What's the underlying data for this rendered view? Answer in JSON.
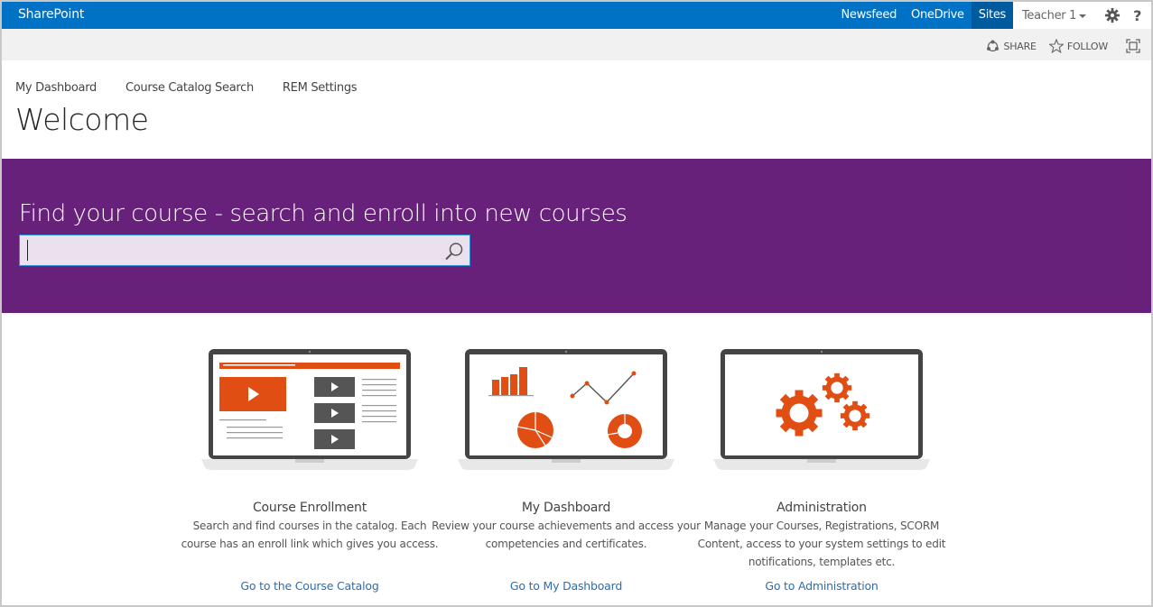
{
  "app": {
    "brand": "SharePoint"
  },
  "suitebar": {
    "links": [
      "Newsfeed",
      "OneDrive",
      "Sites"
    ],
    "selected": "Sites",
    "user": "Teacher 1",
    "help": "?"
  },
  "ribbon": {
    "share": "SHARE",
    "follow": "FOLLOW"
  },
  "topnav": [
    "My Dashboard",
    "Course Catalog Search",
    "REM Settings"
  ],
  "page": {
    "title": "Welcome"
  },
  "hero": {
    "title": "Find your course - search and enroll into new courses",
    "search_value": "",
    "background": "#68217a"
  },
  "tiles": [
    {
      "title": "Course Enrollment",
      "description": "Search and find courses in the catalog. Each course has an enroll link which gives you access.",
      "link": "Go to the Course Catalog"
    },
    {
      "title": "My Dashboard",
      "description": "Review your course achievements and access your competencies and certificates.",
      "link": "Go to My Dashboard"
    },
    {
      "title": "Administration",
      "description": "Manage your Courses, Registrations, SCORM Content, access to your system settings to edit notifications, templates etc.",
      "link": "Go to Administration"
    }
  ],
  "colors": {
    "suitebar": "#0072c6",
    "accent": "#e04e14",
    "link": "#2a6db6"
  }
}
